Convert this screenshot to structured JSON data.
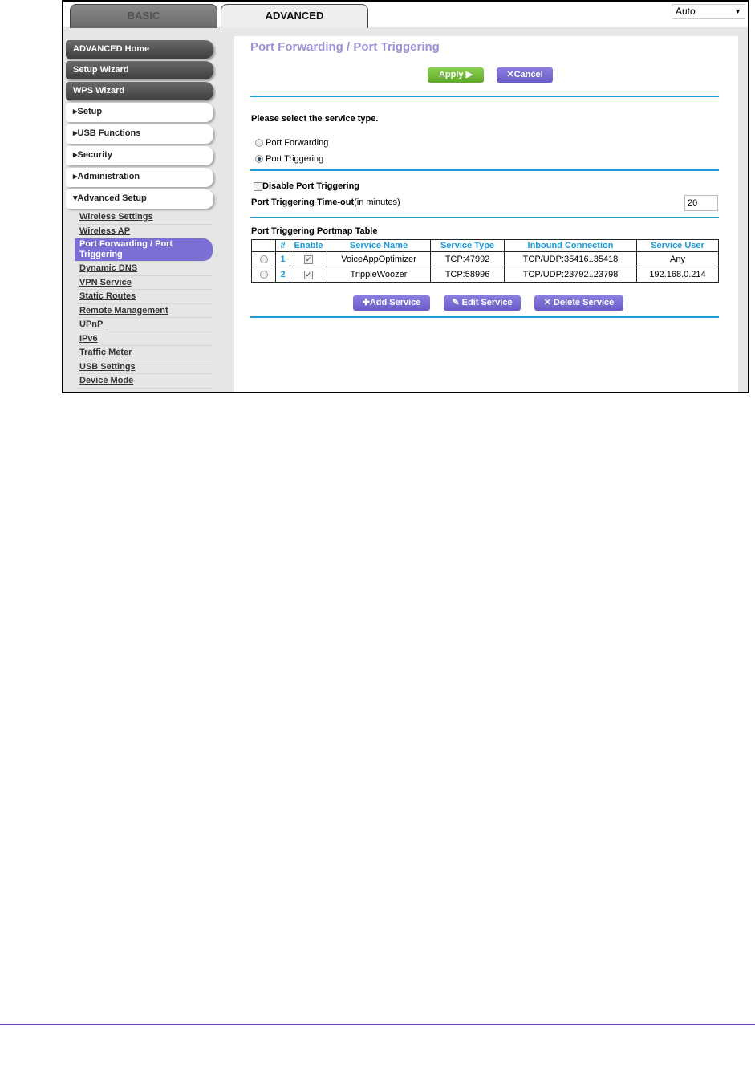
{
  "tabs": {
    "basic": "BASIC",
    "advanced": "ADVANCED"
  },
  "language_select": {
    "value": "Auto",
    "icon": "chevron-down-icon"
  },
  "sidebar": {
    "dark_buttons": [
      "ADVANCED Home",
      "Setup Wizard",
      "WPS Wizard"
    ],
    "sections": [
      "Setup",
      "USB Functions",
      "Security",
      "Administration",
      "Advanced Setup"
    ],
    "sub_items": [
      "Wireless Settings",
      "Wireless AP",
      "Port Forwarding / Port Triggering",
      "Dynamic DNS",
      "VPN Service",
      "Static Routes",
      "Remote Management",
      "UPnP",
      "IPv6",
      "Traffic Meter",
      "USB Settings",
      "Device Mode"
    ],
    "active_sub": "Port Forwarding / Port Triggering"
  },
  "main": {
    "title": "Port Forwarding / Port Triggering",
    "apply": "Apply ▶",
    "cancel": "Cancel",
    "service_type_prompt": "Please select the service type.",
    "radio_forwarding": "Port Forwarding",
    "radio_triggering": "Port Triggering",
    "selected_service_type": "Port Triggering",
    "disable_label": "Disable Port Triggering",
    "disable_checked": false,
    "timeout_label": "Port Triggering Time-out",
    "timeout_unit": "(in minutes)",
    "timeout_value": "20",
    "table_title": "Port Triggering Portmap Table",
    "columns": [
      "",
      "#",
      "Enable",
      "Service Name",
      "Service Type",
      "Inbound Connection",
      "Service User"
    ],
    "rows": [
      {
        "num": "1",
        "enabled": true,
        "name": "VoiceAppOptimizer",
        "type": "TCP:47992",
        "inbound": "TCP/UDP:35416..35418",
        "user": "Any"
      },
      {
        "num": "2",
        "enabled": true,
        "name": "TrippleWoozer",
        "type": "TCP:58996",
        "inbound": "TCP/UDP:23792..23798",
        "user": "192.168.0.214"
      }
    ],
    "add": "Add Service",
    "edit": "Edit Service",
    "delete": "Delete Service"
  },
  "colors": {
    "accent_blue": "#1e9ad6",
    "purple": "#7b6fd6",
    "green": "#6cb83a"
  }
}
